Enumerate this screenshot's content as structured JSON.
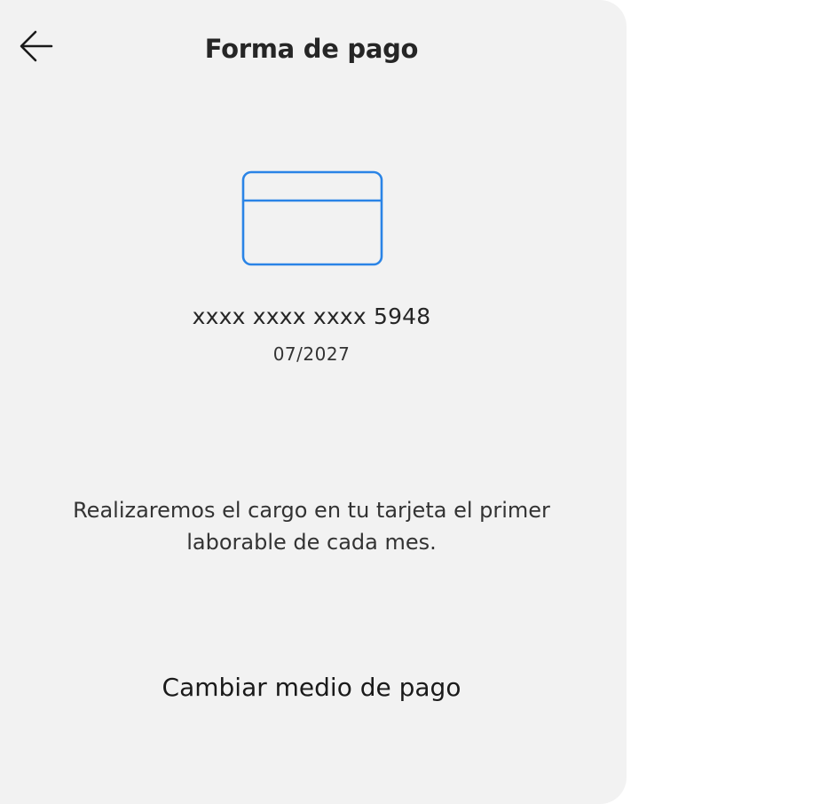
{
  "header": {
    "title": "Forma de pago",
    "back_icon": "arrow-left-icon"
  },
  "card": {
    "icon": "credit-card-icon",
    "icon_color": "#2a84e6",
    "number": "xxxx xxxx xxxx 5948",
    "expiry": "07/2027"
  },
  "info": {
    "charge_note": "Realizaremos el cargo en tu tarjeta el primer laborable de cada mes."
  },
  "actions": {
    "change_payment_label": "Cambiar medio de pago"
  },
  "colors": {
    "panel_background": "#f2f2f2",
    "text": "#262626"
  }
}
